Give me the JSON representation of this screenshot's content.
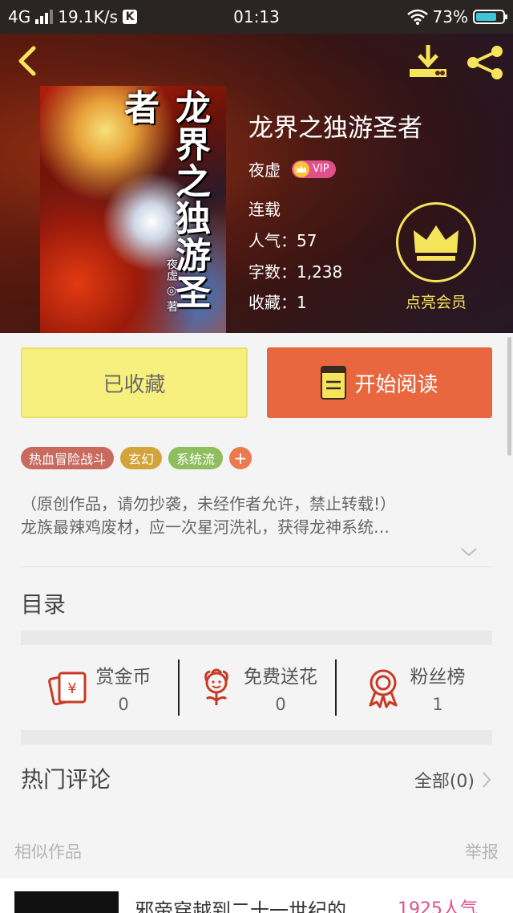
{
  "status_bar": {
    "network": "4G",
    "speed": "19.1K/s",
    "app_badge": "K",
    "time": "01:13",
    "battery": "73%"
  },
  "header": {
    "icons": [
      "back-icon",
      "download-icon",
      "share-icon"
    ]
  },
  "book": {
    "cover_title": "龙界之独游圣者",
    "cover_author": "夜虚 ◎ 著",
    "title": "龙界之独游圣者",
    "author": "夜虚",
    "vip": "VIP",
    "status": "连载",
    "popularity": "人气：57",
    "word_count": "字数：1,238",
    "favorites": "收藏：1"
  },
  "member": {
    "label": "点亮会员",
    "color": "#f6e45a"
  },
  "actions": {
    "collected_label": "已收藏",
    "read_label": "开始阅读"
  },
  "tags": [
    "热血冒险战斗",
    "玄幻",
    "系统流",
    "+"
  ],
  "description": {
    "line1": "（原创作品，请勿抄袭，未经作者允许，禁止转载!）",
    "line2": "龙族最辣鸡废材，应一次星河洗礼，获得龙神系统…"
  },
  "toc": {
    "title": "目录"
  },
  "stats": [
    {
      "label": "赏金币",
      "value": "0",
      "icon": "coin-envelope-icon"
    },
    {
      "label": "免费送花",
      "value": "0",
      "icon": "flower-icon"
    },
    {
      "label": "粉丝榜",
      "value": "1",
      "icon": "medal-icon"
    }
  ],
  "comments": {
    "title": "热门评论",
    "all_label": "全部(0)"
  },
  "similar": {
    "title": "相似作品",
    "report_label": "举报",
    "items": [
      {
        "title": "邪帝穿越到二十一世纪的…",
        "popularity": "1925人气"
      }
    ]
  },
  "colors": {
    "accent_orange": "#e9673e",
    "collected_yellow": "#f8f07e",
    "vip_pink": "#e0508a"
  }
}
